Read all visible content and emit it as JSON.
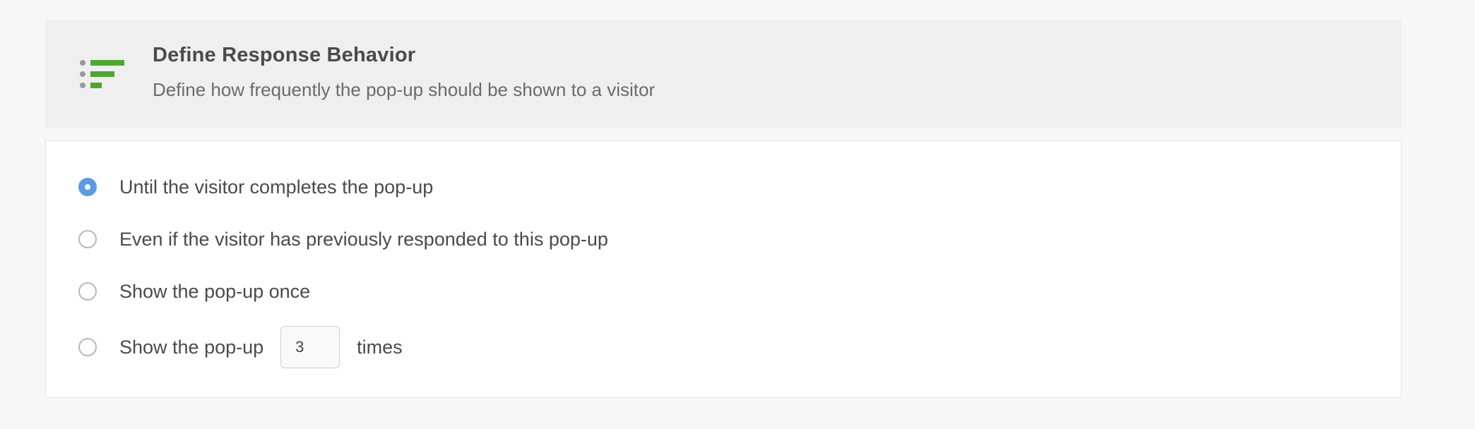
{
  "header": {
    "icon": "response-frequency-icon",
    "title": "Define Response Behavior",
    "subtitle": "Define how frequently the pop-up should be shown to a visitor",
    "icon_colors": {
      "bars": "#4ea82f",
      "dots": "#9a9a9a"
    }
  },
  "options": {
    "selected": "until-complete",
    "items": [
      {
        "id": "until-complete",
        "label": "Until the visitor completes the pop-up",
        "checked": true
      },
      {
        "id": "even-if-responded",
        "label": "Even if the visitor has previously responded to this pop-up",
        "checked": false
      },
      {
        "id": "show-once",
        "label": "Show the pop-up once",
        "checked": false
      },
      {
        "id": "show-n-times",
        "label": "Show the pop-up",
        "checked": false,
        "input_value": "3",
        "suffix": "times"
      }
    ]
  },
  "colors": {
    "radio_selected": "#5a9be6",
    "header_background": "#efefef",
    "page_background": "#f7f7f7"
  }
}
